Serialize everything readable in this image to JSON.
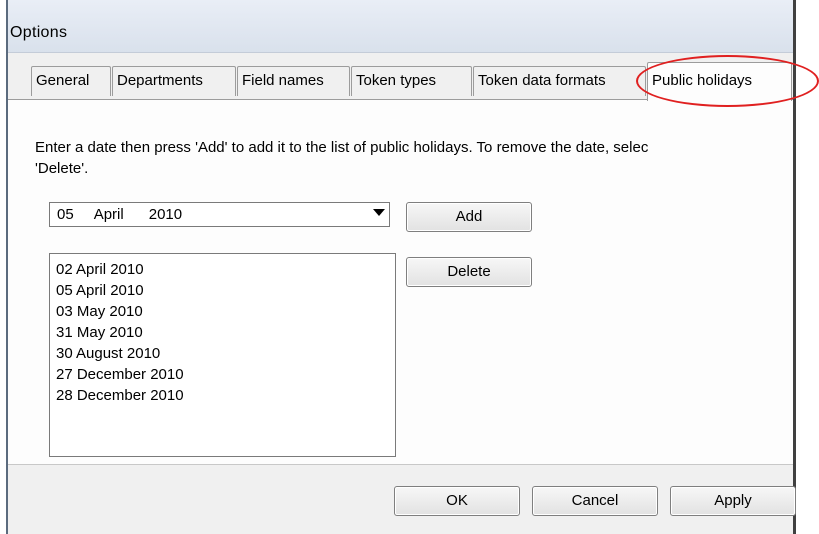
{
  "window": {
    "title": "Options"
  },
  "tabs": [
    {
      "label": "General",
      "active": false
    },
    {
      "label": "Departments",
      "active": false
    },
    {
      "label": "Field names",
      "active": false
    },
    {
      "label": "Token types",
      "active": false
    },
    {
      "label": "Token data formats",
      "active": false
    },
    {
      "label": "Public holidays",
      "active": true
    }
  ],
  "panel": {
    "instructions": "Enter a date then press 'Add' to add it to the list of public holidays. To remove the date, selec\n'Delete'.",
    "date_picker": {
      "day": "05",
      "month": "April",
      "year": "2010"
    },
    "add_label": "Add",
    "delete_label": "Delete",
    "holidays": [
      "02 April 2010",
      "05 April 2010",
      "03 May 2010",
      "31 May 2010",
      "30 August 2010",
      "27 December 2010",
      "28 December 2010"
    ]
  },
  "footer": {
    "ok_label": "OK",
    "cancel_label": "Cancel",
    "apply_label": "Apply"
  },
  "colors": {
    "callout": "#e02020",
    "window_border": "#404040",
    "title_bar": "#dfe6ef"
  }
}
